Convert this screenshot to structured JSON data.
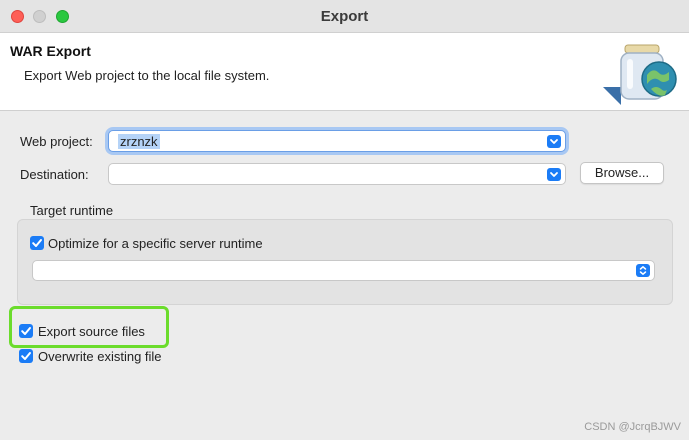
{
  "window": {
    "title": "Export"
  },
  "banner": {
    "title": "WAR Export",
    "description": "Export Web project to the local file system.",
    "icon": "export-jar-globe-icon"
  },
  "form": {
    "web_project_label": "Web project:",
    "web_project_value": "zrznzk",
    "destination_label": "Destination:",
    "destination_value": "",
    "browse_label": "Browse..."
  },
  "target_runtime": {
    "title": "Target runtime",
    "optimize_label": "Optimize for a specific server runtime",
    "optimize_checked": true,
    "runtime_value": ""
  },
  "options": {
    "export_source_label": "Export source files",
    "export_source_checked": true,
    "overwrite_label": "Overwrite existing file",
    "overwrite_checked": true
  },
  "watermark": "CSDN @JcrqBJWV",
  "colors": {
    "accent": "#1b7cf6",
    "highlight": "#6bdc2c",
    "focus_ring": "#a8c8f3"
  }
}
